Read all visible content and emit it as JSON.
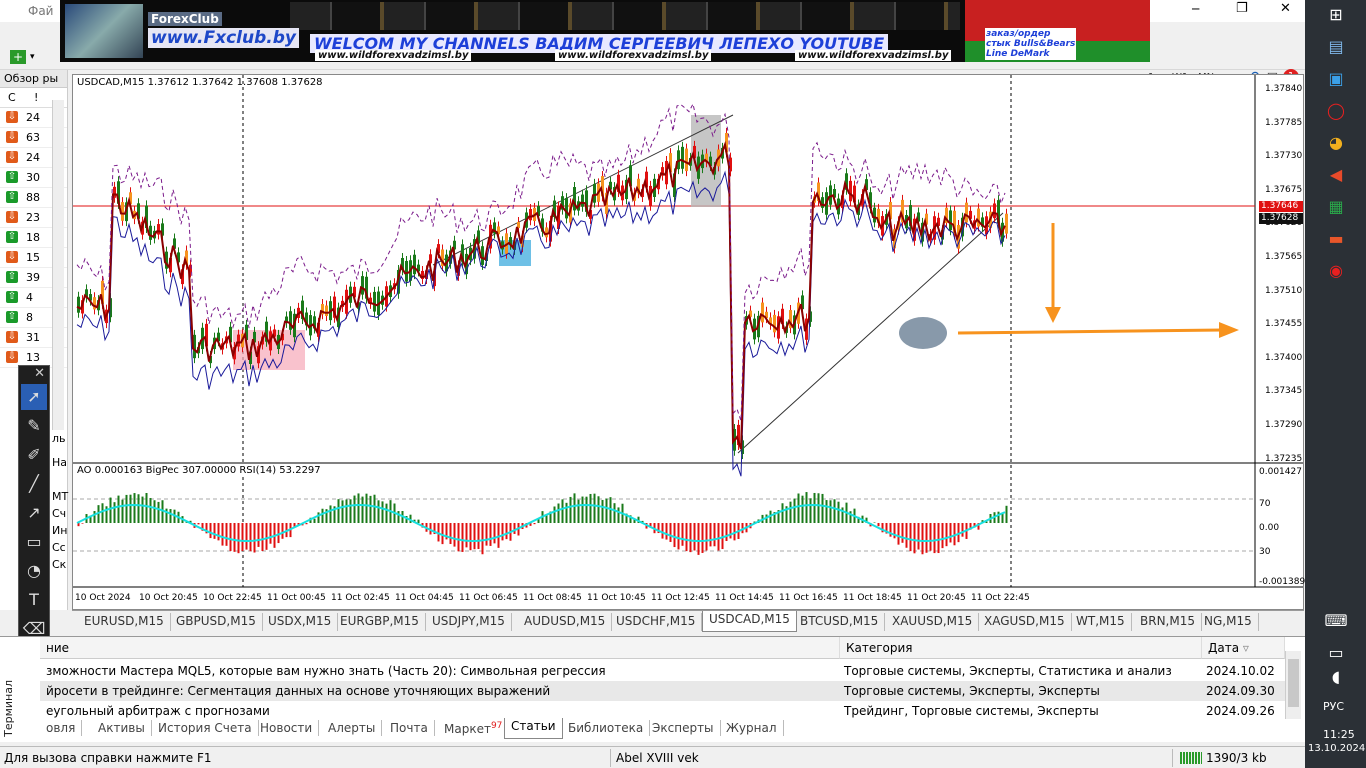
{
  "window": {
    "menu_file": "Фай",
    "minimize": "─",
    "restore": "❐",
    "close": "✕"
  },
  "banner": {
    "forexclub": "ForexClub",
    "site": "www.Fxclub.by",
    "headline": "WELCOM MY CHANNELS ВАДИМ СЕРГЕЕВИЧ ЛЕПЕХО YOUTUBE",
    "urls": [
      "www.wildforexvadzimsl.by",
      "www.wildforexvadzimsl.by",
      "www.wildforexvadzimsl.by"
    ],
    "side_lines": [
      "заказ/ордер",
      "стык Bulls&Bears",
      "Line DeMark"
    ]
  },
  "toolbar": {
    "timeframes": [
      "1",
      "W1",
      "MN"
    ],
    "notification_count": "1"
  },
  "market_watch": {
    "title": "Обзор ры",
    "col_icons": [
      "C",
      "!"
    ],
    "rows": [
      {
        "num": "24",
        "dir": "down",
        "color": "#e05a1a"
      },
      {
        "num": "63",
        "dir": "down",
        "color": "#e05a1a"
      },
      {
        "num": "24",
        "dir": "down",
        "color": "#e05a1a"
      },
      {
        "num": "30",
        "dir": "up",
        "color": "#1a9a2a"
      },
      {
        "num": "88",
        "dir": "up",
        "color": "#1a9a2a"
      },
      {
        "num": "23",
        "dir": "down",
        "color": "#e05a1a"
      },
      {
        "num": "18",
        "dir": "up",
        "color": "#1a9a2a"
      },
      {
        "num": "15",
        "dir": "down",
        "color": "#e05a1a"
      },
      {
        "num": "39",
        "dir": "up",
        "color": "#1a9a2a"
      },
      {
        "num": "4",
        "dir": "up",
        "color": "#1a9a2a"
      },
      {
        "num": "8",
        "dir": "up",
        "color": "#1a9a2a"
      },
      {
        "num": "31",
        "dir": "down",
        "color": "#e05a1a"
      },
      {
        "num": "13",
        "dir": "down",
        "color": "#e05a1a"
      }
    ],
    "side_fragments": [
      "ль",
      "На",
      "MT",
      "Сч",
      "Ин",
      "Сс",
      "Ск"
    ]
  },
  "chart": {
    "header": "USDCAD,M15  1.37612 1.37642 1.37608 1.37628",
    "price_labels": [
      "1.37840",
      "1.37785",
      "1.37730",
      "1.37675",
      "1.37620",
      "1.37565",
      "1.37510",
      "1.37455",
      "1.37400",
      "1.37345",
      "1.37290",
      "1.37235"
    ],
    "red_line_price": "1.37646",
    "current_price": "1.37628",
    "indicator_header": "AO 0.000163  BigPec 307.00000  RSI(14) 53.2297",
    "indicator_labels": [
      "0.001427",
      "70",
      "0.00",
      "30",
      "-0.001389"
    ],
    "time_labels": [
      "10 Oct 2024",
      "10 Oct 20:45",
      "10 Oct 22:45",
      "11 Oct 00:45",
      "11 Oct 02:45",
      "11 Oct 04:45",
      "11 Oct 06:45",
      "11 Oct 08:45",
      "11 Oct 10:45",
      "11 Oct 12:45",
      "11 Oct 14:45",
      "11 Oct 16:45",
      "11 Oct 18:45",
      "11 Oct 20:45",
      "11 Oct 22:45"
    ],
    "colors": {
      "bull": "#1a7a1a",
      "bear": "#e01010",
      "orange": "#f7931e",
      "ma_red": "#8b0000",
      "ma_blue": "#1a1a9a",
      "rsi": "#18e0e0"
    }
  },
  "chart_tabs": [
    "EURUSD,M15",
    "GBPUSD,M15",
    "USDX,M15",
    "EURGBP,M15",
    "USDJPY,M15",
    "AUDUSD,M15",
    "USDCHF,M15",
    "USDCAD,M15",
    "BTCUSD,M15",
    "XAUUSD,M15",
    "XAGUSD,M15",
    "WT,M15",
    "BRN,M15",
    "NG,M15"
  ],
  "active_chart_tab": "USDCAD,M15",
  "terminal": {
    "col_name": "ние",
    "col_category": "Категория",
    "col_date": "Дата",
    "rows": [
      {
        "title": "зможности Мастера MQL5, которые вам нужно знать (Часть 20): Символьная регрессия",
        "category": "Торговые системы, Эксперты, Статистика и анализ",
        "date": "2024.10.02"
      },
      {
        "title": "йросети в трейдинге: Сегментация данных на основе уточняющих выражений",
        "category": "Торговые системы, Эксперты, Эксперты",
        "date": "2024.09.30"
      },
      {
        "title": "еугольный арбитраж с прогнозами",
        "category": "Трейдинг, Торговые системы, Эксперты",
        "date": "2024.09.26"
      }
    ],
    "tabs": [
      "овля",
      "Активы",
      "История Счета",
      "Новости",
      "Алерты",
      "Почта",
      "Маркет",
      "Статьи",
      "Библиотека",
      "Эксперты",
      "Журнал"
    ],
    "market_badge": "97",
    "active_tab": "Статьи",
    "side_label": "Терминал"
  },
  "status": {
    "help": "Для вызова справки нажмите F1",
    "profile": "Abel XVIII vek",
    "traffic": "1390/3 kb"
  },
  "taskbar": {
    "lang": "РУС",
    "time": "11:25",
    "date": "13.10.2024"
  }
}
